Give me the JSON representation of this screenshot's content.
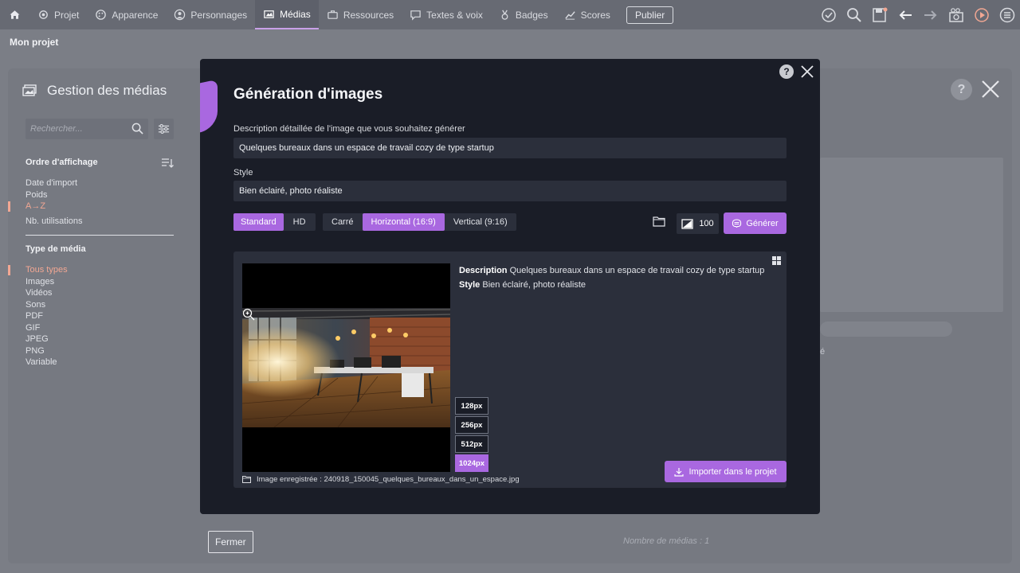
{
  "nav": {
    "items": [
      {
        "label": "Projet",
        "icon": "gear-icon"
      },
      {
        "label": "Apparence",
        "icon": "palette-icon"
      },
      {
        "label": "Personnages",
        "icon": "user-icon"
      },
      {
        "label": "Médias",
        "icon": "media-icon"
      },
      {
        "label": "Ressources",
        "icon": "briefcase-icon"
      },
      {
        "label": "Textes & voix",
        "icon": "chat-icon"
      },
      {
        "label": "Badges",
        "icon": "medal-icon"
      },
      {
        "label": "Scores",
        "icon": "chart-icon"
      }
    ],
    "publish_label": "Publier",
    "active": "Médias"
  },
  "project_name": "Mon projet",
  "panel": {
    "title": "Gestion des médias",
    "search_placeholder": "Rechercher...",
    "order_heading": "Ordre d'affichage",
    "order_items": [
      "Date d'import",
      "Poids",
      "A→Z",
      "Nb. utilisations"
    ],
    "order_selected": "A→Z",
    "type_heading": "Type de média",
    "type_items": [
      "Tous types",
      "Images",
      "Vidéos",
      "Sons",
      "PDF",
      "GIF",
      "JPEG",
      "PNG",
      "Variable"
    ],
    "type_selected": "Tous types",
    "right_text_fragment": "é",
    "close_label": "Fermer",
    "media_count": "Nombre de médias : 1"
  },
  "modal": {
    "title": "Génération d'images",
    "help_label": "?",
    "description_label": "Description détaillée de l'image que vous souhaitez générer",
    "description_value": "Quelques bureaux dans un espace de travail cozy de type startup",
    "style_label": "Style",
    "style_value": "Bien éclairé, photo réaliste",
    "quality_options": [
      "Standard",
      "HD"
    ],
    "quality_selected": "Standard",
    "format_options": [
      "Carré",
      "Horizontal (16:9)",
      "Vertical (9:16)"
    ],
    "format_selected": "Horizontal (16:9)",
    "count_value": "100",
    "generate_label": "Générer",
    "result": {
      "description_key": "Description",
      "description_text": "Quelques bureaux dans un espace de travail cozy de type startup",
      "style_key": "Style",
      "style_text": "Bien éclairé, photo réaliste",
      "sizes": [
        "128px",
        "256px",
        "512px",
        "1024px"
      ],
      "size_selected": "1024px",
      "saved_text": "Image enregistrée : 240918_150045_quelques_bureaux_dans_un_espace.jpg",
      "import_label": "Importer dans le projet"
    }
  },
  "colors": {
    "accent": "#a968e0",
    "selected_text": "#f2a793",
    "modal_bg": "#1a1d27",
    "field_bg": "#2b2f3b"
  }
}
